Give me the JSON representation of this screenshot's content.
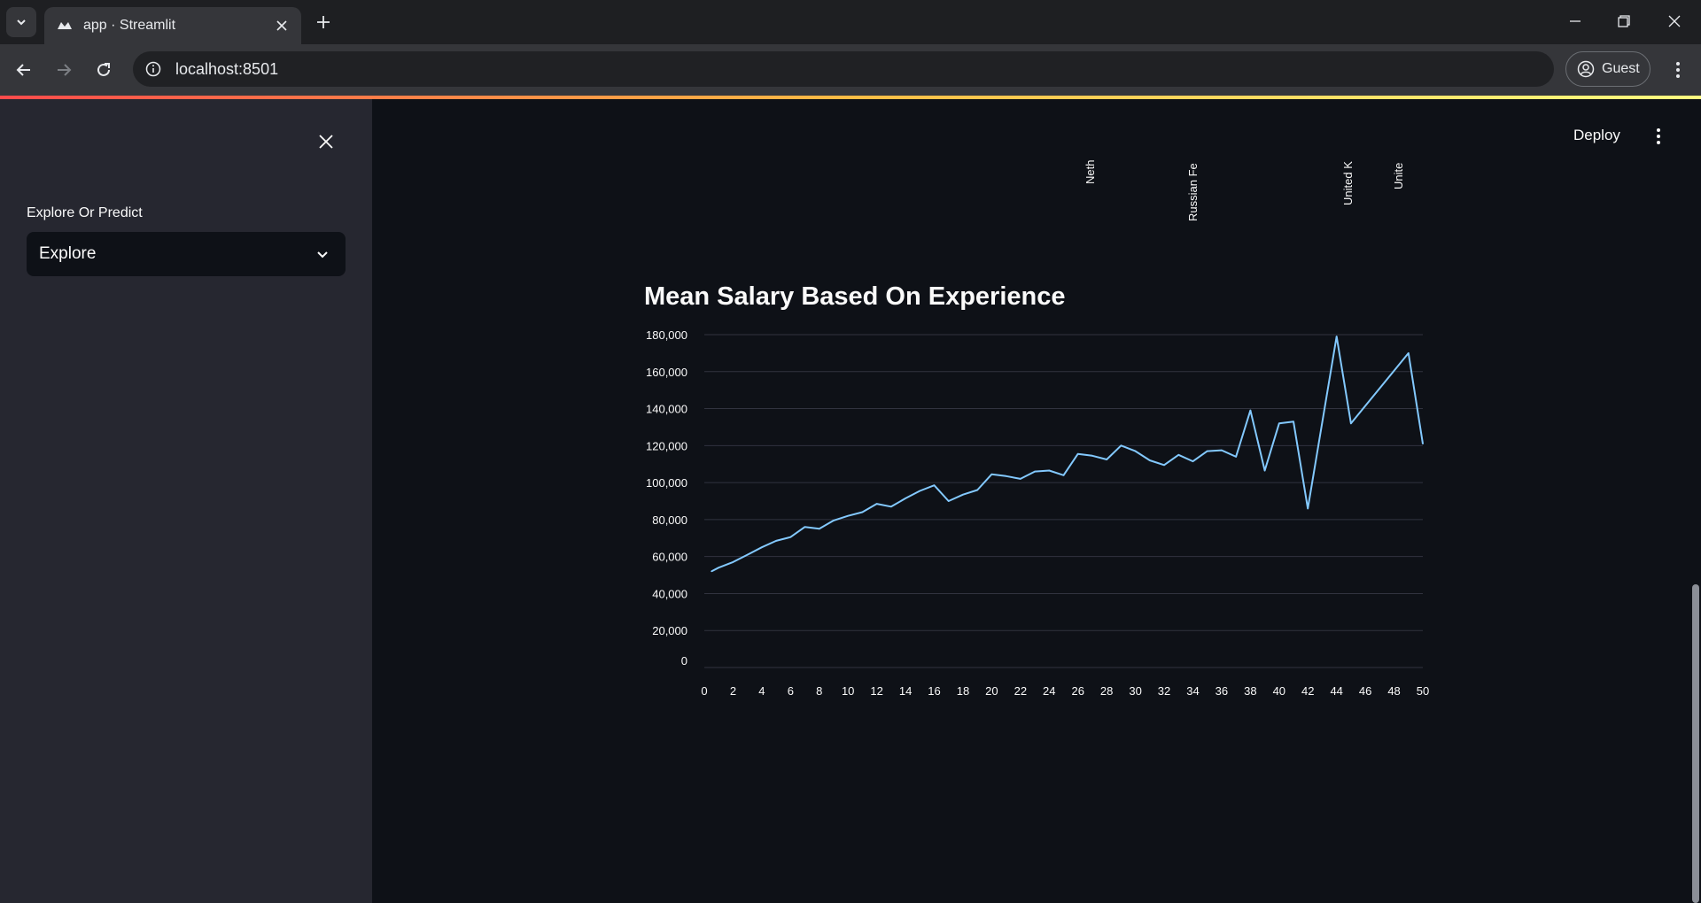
{
  "browser": {
    "tab_title": "app · Streamlit",
    "url": "localhost:8501",
    "profile_label": "Guest"
  },
  "sidebar": {
    "select_label": "Explore Or Predict",
    "select_value": "Explore"
  },
  "header": {
    "deploy_label": "Deploy"
  },
  "previous_chart": {
    "visible_labels": [
      "Neth",
      "Russian Fe",
      "United K",
      "Unite"
    ]
  },
  "section": {
    "title": "Mean Salary Based On Experience"
  },
  "colors": {
    "line": "#83c9ff",
    "background": "#0e1117",
    "sidebar": "#262730",
    "grid": "#31333f"
  },
  "chart_data": {
    "type": "line",
    "title": "",
    "xlabel": "",
    "ylabel": "",
    "xlim": [
      0,
      50
    ],
    "ylim": [
      0,
      180000
    ],
    "x_ticks": [
      0,
      2,
      4,
      6,
      8,
      10,
      12,
      14,
      16,
      18,
      20,
      22,
      24,
      26,
      28,
      30,
      32,
      34,
      36,
      38,
      40,
      42,
      44,
      46,
      48,
      50
    ],
    "y_ticks": [
      0,
      20000,
      40000,
      60000,
      80000,
      100000,
      120000,
      140000,
      160000,
      180000
    ],
    "grid": true,
    "series": [
      {
        "x": [
          0.5,
          1,
          2,
          3,
          4,
          5,
          6,
          7,
          8,
          9,
          10,
          11,
          12,
          13,
          14,
          15,
          16,
          17,
          18,
          19,
          20,
          21,
          22,
          23,
          24,
          25,
          26,
          27,
          28,
          29,
          30,
          31,
          32,
          33,
          34,
          35,
          36,
          37,
          38,
          39,
          40,
          41,
          42,
          44,
          45,
          49,
          50
        ],
        "values": [
          52000,
          54000,
          57000,
          61000,
          65000,
          68500,
          70500,
          76000,
          75000,
          79500,
          82000,
          84000,
          88500,
          87000,
          91500,
          95500,
          98500,
          90000,
          93500,
          96000,
          104500,
          103500,
          102000,
          106000,
          106500,
          104000,
          115500,
          114500,
          112500,
          120000,
          117000,
          112000,
          109500,
          115000,
          111500,
          117000,
          117500,
          114000,
          139000,
          106500,
          132000,
          133000,
          86000,
          179000,
          132000,
          170000,
          121000
        ]
      }
    ]
  }
}
